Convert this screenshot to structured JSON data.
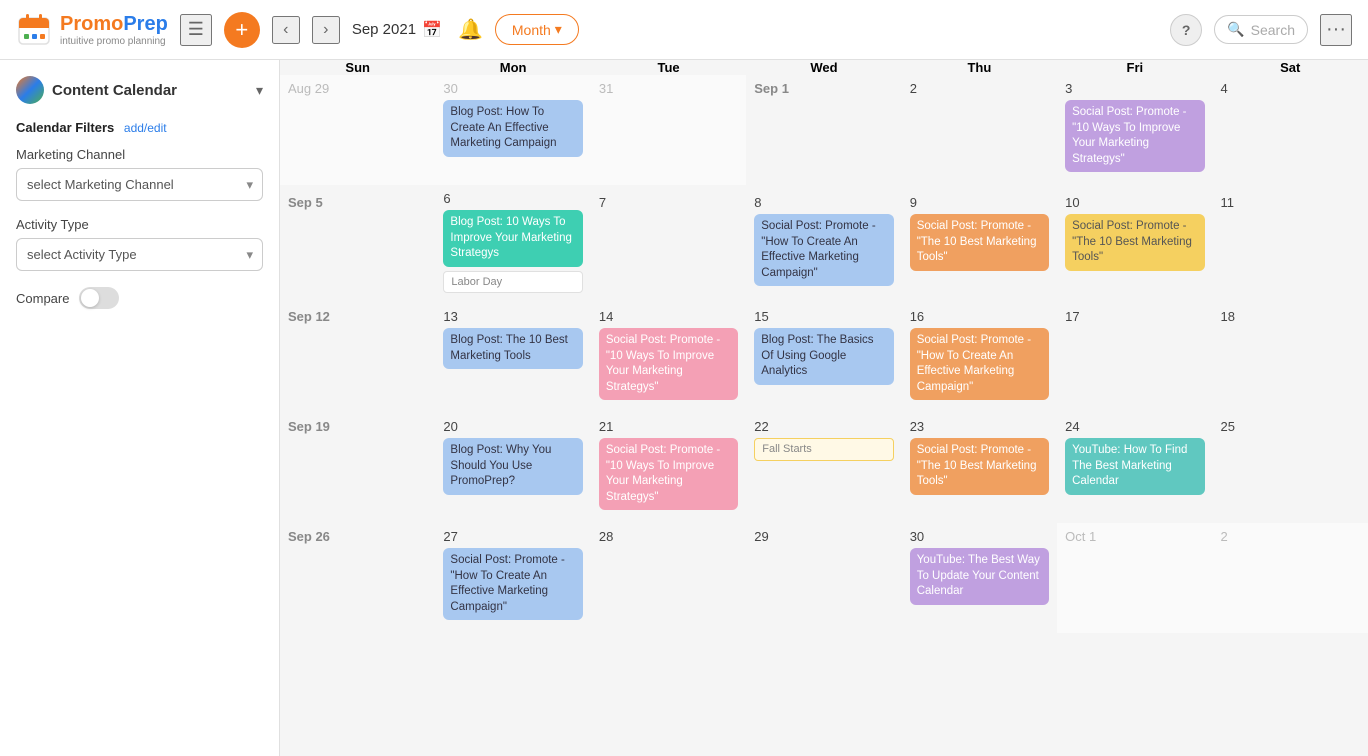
{
  "topbar": {
    "logo_name_part1": "Promo",
    "logo_name_part2": "Prep",
    "logo_sub": "intuitive promo planning",
    "date": "Sep 2021",
    "month_btn": "Month",
    "search_placeholder": "Search",
    "help_label": "?"
  },
  "sidebar": {
    "cc_title": "Content Calendar",
    "filters_title": "Calendar Filters",
    "filters_link": "add/edit",
    "marketing_channel_label": "Marketing Channel",
    "marketing_channel_placeholder": "select Marketing Channel",
    "activity_type_label": "Activity Type",
    "activity_type_placeholder": "select Activity Type",
    "compare_label": "Compare"
  },
  "calendar": {
    "headers": [
      "Sun",
      "Mon",
      "Tue",
      "Wed",
      "Thu",
      "Fri",
      "Sat"
    ],
    "weeks": [
      {
        "days": [
          {
            "date": "Aug 29",
            "dim": true,
            "events": []
          },
          {
            "date": "30",
            "dim": true,
            "events": [
              {
                "type": "chip-blue",
                "text": "Blog Post: How To Create An Effective Marketing Campaign"
              }
            ]
          },
          {
            "date": "31",
            "dim": true,
            "events": []
          },
          {
            "date": "Sep 1",
            "month_start": true,
            "events": []
          },
          {
            "date": "2",
            "events": []
          },
          {
            "date": "3",
            "events": [
              {
                "type": "chip-purple",
                "text": "Social Post: Promote - \"10 Ways To Improve Your Marketing Strategys\""
              }
            ]
          },
          {
            "date": "4",
            "events": []
          }
        ]
      },
      {
        "days": [
          {
            "date": "Sep 5",
            "month_start": true,
            "events": []
          },
          {
            "date": "6",
            "events": [
              {
                "type": "chip-green",
                "text": "Blog Post: 10 Ways To Improve Your Marketing Strategys"
              },
              {
                "type": "chip-holiday",
                "text": "Labor Day"
              }
            ]
          },
          {
            "date": "7",
            "events": []
          },
          {
            "date": "8",
            "events": [
              {
                "type": "chip-blue",
                "text": "Social Post: Promote - \"How To Create An Effective Marketing Campaign\""
              }
            ]
          },
          {
            "date": "9",
            "events": [
              {
                "type": "chip-orange",
                "text": "Social Post: Promote - \"The 10 Best Marketing Tools\""
              }
            ]
          },
          {
            "date": "10",
            "events": [
              {
                "type": "chip-yellow",
                "text": "Social Post: Promote - \"The 10 Best Marketing Tools\""
              }
            ]
          },
          {
            "date": "11",
            "events": []
          }
        ]
      },
      {
        "days": [
          {
            "date": "Sep 12",
            "month_start": true,
            "events": []
          },
          {
            "date": "13",
            "events": [
              {
                "type": "chip-blue",
                "text": "Blog Post: The 10 Best Marketing Tools"
              }
            ]
          },
          {
            "date": "14",
            "events": [
              {
                "type": "chip-pink",
                "text": "Social Post: Promote - \"10 Ways To Improve Your Marketing Strategys\""
              }
            ]
          },
          {
            "date": "15",
            "events": [
              {
                "type": "chip-blue",
                "text": "Blog Post: The Basics Of Using Google Analytics"
              }
            ]
          },
          {
            "date": "16",
            "events": [
              {
                "type": "chip-orange",
                "text": "Social Post: Promote - \"How To Create An Effective Marketing Campaign\""
              }
            ]
          },
          {
            "date": "17",
            "events": []
          },
          {
            "date": "18",
            "events": []
          }
        ]
      },
      {
        "days": [
          {
            "date": "Sep 19",
            "month_start": true,
            "events": []
          },
          {
            "date": "20",
            "events": [
              {
                "type": "chip-blue",
                "text": "Blog Post: Why You Should You Use PromoPrep?"
              }
            ]
          },
          {
            "date": "21",
            "events": [
              {
                "type": "chip-pink",
                "text": "Social Post: Promote - \"10 Ways To Improve Your Marketing Strategys\""
              }
            ]
          },
          {
            "date": "22",
            "events": [
              {
                "type": "chip-fallstarts",
                "text": "Fall Starts"
              }
            ]
          },
          {
            "date": "23",
            "events": [
              {
                "type": "chip-orange",
                "text": "Social Post: Promote - \"The 10 Best Marketing Tools\""
              }
            ]
          },
          {
            "date": "24",
            "events": [
              {
                "type": "chip-teal",
                "text": "YouTube: How To Find The Best Marketing Calendar"
              }
            ]
          },
          {
            "date": "25",
            "events": []
          }
        ]
      },
      {
        "days": [
          {
            "date": "Sep 26",
            "month_start": true,
            "events": []
          },
          {
            "date": "27",
            "events": [
              {
                "type": "chip-blue",
                "text": "Social Post: Promote - \"How To Create An Effective Marketing Campaign\""
              }
            ]
          },
          {
            "date": "28",
            "events": []
          },
          {
            "date": "29",
            "events": []
          },
          {
            "date": "30",
            "events": [
              {
                "type": "chip-purple",
                "text": "YouTube: The Best Way To Update Your Content Calendar"
              }
            ]
          },
          {
            "date": "Oct 1",
            "dim": true,
            "events": []
          },
          {
            "date": "2",
            "dim": true,
            "events": []
          }
        ]
      }
    ]
  }
}
